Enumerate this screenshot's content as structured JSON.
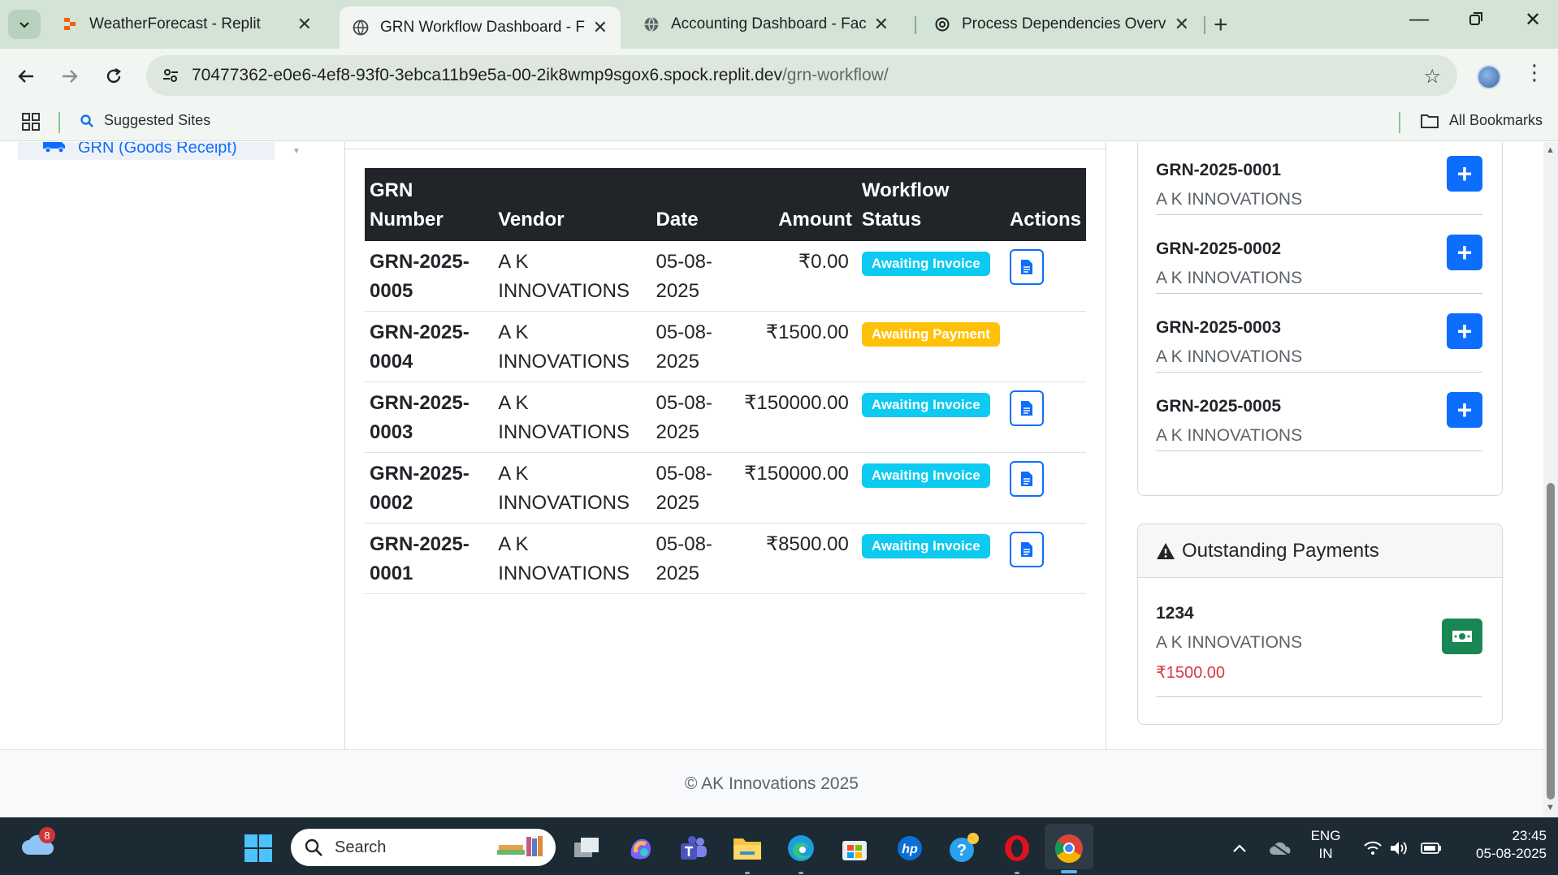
{
  "browser": {
    "tabs": [
      {
        "title": "WeatherForecast - Replit",
        "active": false
      },
      {
        "title": "GRN Workflow Dashboard - Factory",
        "active": true
      },
      {
        "title": "Accounting Dashboard - Factory",
        "active": false
      },
      {
        "title": "Process Dependencies Overview",
        "active": false
      }
    ],
    "url_host": "70477362-e0e6-4ef8-93f0-3ebca11b9e5a-00-2ik8wmp9sgox6.spock.replit.dev",
    "url_path": "/grn-workflow/",
    "bookmarks": {
      "suggested": "Suggested Sites",
      "all": "All Bookmarks"
    }
  },
  "sidebar": {
    "active_item": "GRN (Goods Receipt)"
  },
  "grn_table": {
    "headers": {
      "number": "GRN Number",
      "vendor": "Vendor",
      "date": "Date",
      "amount": "Amount",
      "status": "Workflow Status",
      "actions": "Actions"
    },
    "rows": [
      {
        "number": "GRN-2025-0005",
        "vendor": "A K INNOVATIONS",
        "date": "05-08-2025",
        "amount": "₹0.00",
        "status": "Awaiting Invoice",
        "status_type": "info",
        "has_action": true
      },
      {
        "number": "GRN-2025-0004",
        "vendor": "A K INNOVATIONS",
        "date": "05-08-2025",
        "amount": "₹1500.00",
        "status": "Awaiting Payment",
        "status_type": "warning",
        "has_action": false
      },
      {
        "number": "GRN-2025-0003",
        "vendor": "A K INNOVATIONS",
        "date": "05-08-2025",
        "amount": "₹150000.00",
        "status": "Awaiting Invoice",
        "status_type": "info",
        "has_action": true
      },
      {
        "number": "GRN-2025-0002",
        "vendor": "A K INNOVATIONS",
        "date": "05-08-2025",
        "amount": "₹150000.00",
        "status": "Awaiting Invoice",
        "status_type": "info",
        "has_action": true
      },
      {
        "number": "GRN-2025-0001",
        "vendor": "A K INNOVATIONS",
        "date": "05-08-2025",
        "amount": "₹8500.00",
        "status": "Awaiting Invoice",
        "status_type": "info",
        "has_action": true
      }
    ]
  },
  "pending_invoices": {
    "items": [
      {
        "number": "GRN-2025-0001",
        "vendor": "A K INNOVATIONS"
      },
      {
        "number": "GRN-2025-0002",
        "vendor": "A K INNOVATIONS"
      },
      {
        "number": "GRN-2025-0003",
        "vendor": "A K INNOVATIONS"
      },
      {
        "number": "GRN-2025-0005",
        "vendor": "A K INNOVATIONS"
      }
    ]
  },
  "outstanding_payments": {
    "title": "Outstanding Payments",
    "items": [
      {
        "ref": "1234",
        "vendor": "A K INNOVATIONS",
        "amount": "₹1500.00"
      }
    ]
  },
  "footer": {
    "text": "© AK Innovations 2025"
  },
  "taskbar": {
    "weather_badge": "8",
    "search_label": "Search",
    "lang_top": "ENG",
    "lang_bottom": "IN",
    "time": "23:45",
    "date": "05-08-2025"
  },
  "colors": {
    "primary": "#0d6efd",
    "info": "#0dcaf0",
    "warning": "#ffc107",
    "success": "#198754",
    "danger": "#dc3545",
    "table_header": "#212529"
  }
}
